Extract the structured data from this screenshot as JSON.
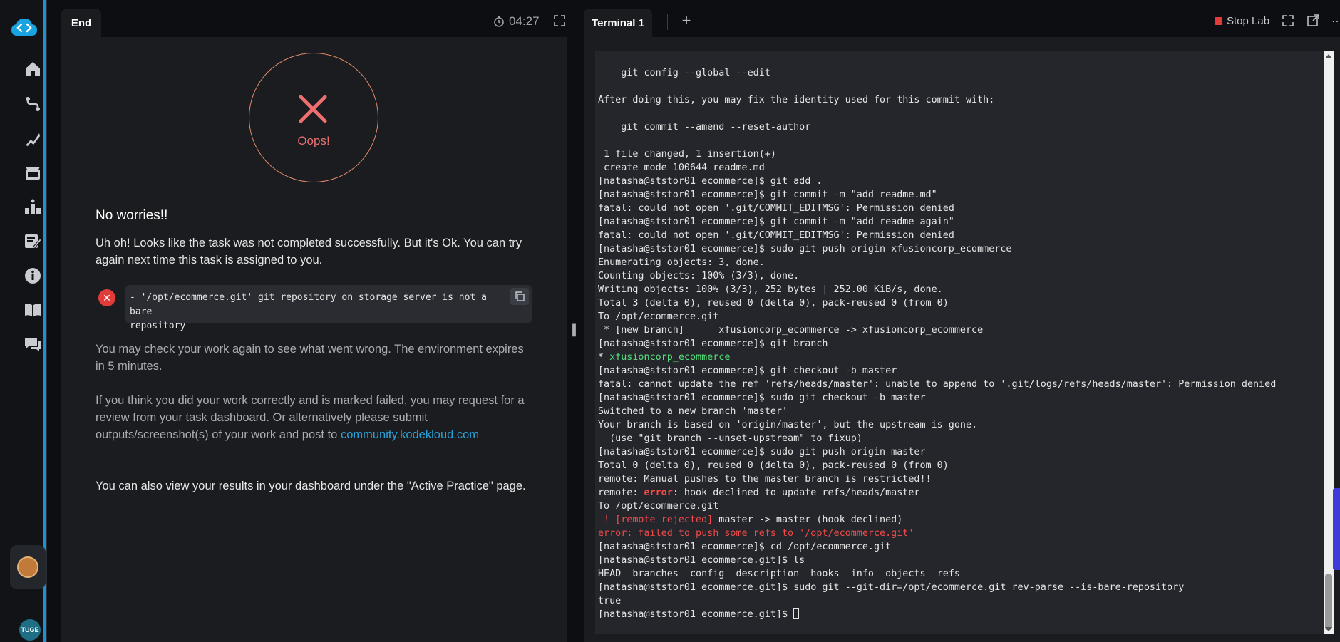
{
  "sidebar": {
    "logo": "kodekloud-logo",
    "items": [
      {
        "icon": "home-icon"
      },
      {
        "icon": "roadmap-icon"
      },
      {
        "icon": "skill-icon"
      },
      {
        "icon": "video-icon"
      },
      {
        "icon": "leaderboard-icon"
      },
      {
        "icon": "tasks-icon"
      },
      {
        "icon": "info-icon"
      },
      {
        "icon": "docs-icon"
      },
      {
        "icon": "chat-icon"
      }
    ],
    "user_badge": "TUGE"
  },
  "left": {
    "tab_label": "End",
    "timer": "04:27",
    "oops": "Oops!",
    "heading": "No worries!!",
    "intro": "Uh oh! Looks like the task was not completed successfully. But it's Ok. You can try again next time this task is assigned to you.",
    "error_line1": "- '/opt/ecommerce.git' git repository on storage server is not a bare",
    "error_line2": "repository",
    "check_text": "You may check your work again to see what went wrong. The environment expires in 5 minutes.",
    "review_text": "If you think you did your work correctly and is marked failed, you may request for a review from your task dashboard. Or alternatively please submit outputs/screenshot(s) of your work and post to",
    "review_link": "community.kodekloud.com",
    "dashboard_text": "You can also view your results in your dashboard under the \"Active Practice\" page."
  },
  "right": {
    "tab_label": "Terminal 1",
    "stop_label": "Stop Lab"
  },
  "terminal": {
    "lines": [
      {
        "t": "    git config --global --edit",
        "c": ""
      },
      {
        "t": "",
        "c": ""
      },
      {
        "t": "After doing this, you may fix the identity used for this commit with:",
        "c": ""
      },
      {
        "t": "",
        "c": ""
      },
      {
        "t": "    git commit --amend --reset-author",
        "c": ""
      },
      {
        "t": "",
        "c": ""
      },
      {
        "t": " 1 file changed, 1 insertion(+)",
        "c": ""
      },
      {
        "t": " create mode 100644 readme.md",
        "c": ""
      },
      {
        "t": "[natasha@ststor01 ecommerce]$ git add .",
        "c": ""
      },
      {
        "t": "[natasha@ststor01 ecommerce]$ git commit -m \"add readme.md\"",
        "c": ""
      },
      {
        "t": "fatal: could not open '.git/COMMIT_EDITMSG': Permission denied",
        "c": ""
      },
      {
        "t": "[natasha@ststor01 ecommerce]$ git commit -m \"add readme again\"",
        "c": ""
      },
      {
        "t": "fatal: could not open '.git/COMMIT_EDITMSG': Permission denied",
        "c": ""
      },
      {
        "t": "[natasha@ststor01 ecommerce]$ sudo git push origin xfusioncorp_ecommerce",
        "c": ""
      },
      {
        "t": "Enumerating objects: 3, done.",
        "c": ""
      },
      {
        "t": "Counting objects: 100% (3/3), done.",
        "c": ""
      },
      {
        "t": "Writing objects: 100% (3/3), 252 bytes | 252.00 KiB/s, done.",
        "c": ""
      },
      {
        "t": "Total 3 (delta 0), reused 0 (delta 0), pack-reused 0 (from 0)",
        "c": ""
      },
      {
        "t": "To /opt/ecommerce.git",
        "c": ""
      },
      {
        "t": " * [new branch]      xfusioncorp_ecommerce -> xfusioncorp_ecommerce",
        "c": ""
      },
      {
        "t": "[natasha@ststor01 ecommerce]$ git branch",
        "c": ""
      },
      {
        "t": "* ",
        "c": "",
        "g": "xfusioncorp_ecommerce"
      },
      {
        "t": "[natasha@ststor01 ecommerce]$ git checkout -b master",
        "c": ""
      },
      {
        "t": "fatal: cannot update the ref 'refs/heads/master': unable to append to '.git/logs/refs/heads/master': Permission denied",
        "c": ""
      },
      {
        "t": "[natasha@ststor01 ecommerce]$ sudo git checkout -b master",
        "c": ""
      },
      {
        "t": "Switched to a new branch 'master'",
        "c": ""
      },
      {
        "t": "Your branch is based on 'origin/master', but the upstream is gone.",
        "c": ""
      },
      {
        "t": "  (use \"git branch --unset-upstream\" to fixup)",
        "c": ""
      },
      {
        "t": "[natasha@ststor01 ecommerce]$ sudo git push origin master",
        "c": ""
      },
      {
        "t": "Total 0 (delta 0), reused 0 (delta 0), pack-reused 0 (from 0)",
        "c": ""
      },
      {
        "t": "remote: Manual pushes to the master branch is restricted!!",
        "c": ""
      },
      {
        "t": "remote: ",
        "c": "",
        "e": "error",
        "rest": ": hook declined to update refs/heads/master"
      },
      {
        "t": "To /opt/ecommerce.git",
        "c": ""
      },
      {
        "t": " ! [remote rejected]",
        "c": "red",
        "rest2": " master -> master (hook declined)"
      },
      {
        "t": "error: failed to push some refs to '/opt/ecommerce.git'",
        "c": "red"
      },
      {
        "t": "[natasha@ststor01 ecommerce]$ cd /opt/ecommerce.git",
        "c": ""
      },
      {
        "t": "[natasha@ststor01 ecommerce.git]$ ls",
        "c": ""
      },
      {
        "t": "HEAD  branches  config  description  hooks  info  objects  refs",
        "c": ""
      },
      {
        "t": "[natasha@ststor01 ecommerce.git]$ sudo git --git-dir=/opt/ecommerce.git rev-parse --is-bare-repository",
        "c": ""
      },
      {
        "t": "true",
        "c": ""
      },
      {
        "t": "[natasha@ststor01 ecommerce.git]$ ",
        "c": "",
        "cursor": true
      }
    ]
  }
}
